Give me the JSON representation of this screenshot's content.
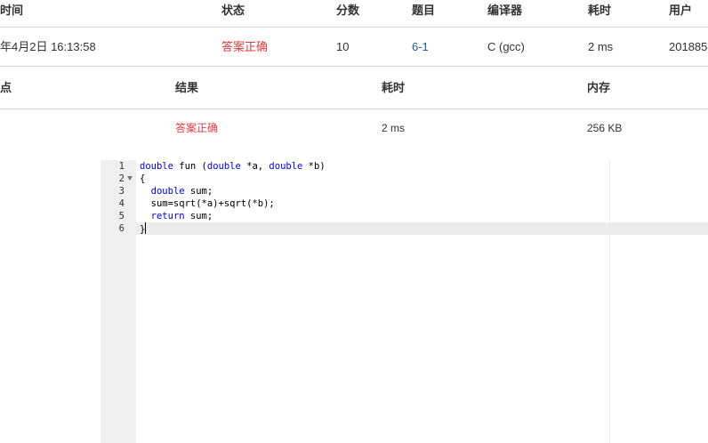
{
  "submission_table": {
    "headers": {
      "time": "时间",
      "status": "状态",
      "score": "分数",
      "problem": "题目",
      "compiler": "编译器",
      "duration": "耗时",
      "user": "用户"
    },
    "row": {
      "time": "年4月2日 16:13:58",
      "status": "答案正确",
      "score": "10",
      "problem": "6-1",
      "compiler": "C (gcc)",
      "duration": "2 ms",
      "user": "201885"
    }
  },
  "testcase_table": {
    "headers": {
      "point": "点",
      "result": "结果",
      "duration": "耗时",
      "memory": "内存"
    },
    "row": {
      "result": "答案正确",
      "duration": "2 ms",
      "memory": "256 KB"
    }
  },
  "code_editor": {
    "line_numbers": [
      "1",
      "2",
      "3",
      "4",
      "5",
      "6"
    ],
    "lines": [
      [
        {
          "t": "double",
          "k": true
        },
        {
          "t": " fun (",
          "k": false
        },
        {
          "t": "double",
          "k": true
        },
        {
          "t": " *a, ",
          "k": false
        },
        {
          "t": "double",
          "k": true
        },
        {
          "t": " *b)",
          "k": false
        }
      ],
      [
        {
          "t": "{",
          "k": false
        }
      ],
      [
        {
          "t": "  ",
          "k": false
        },
        {
          "t": "double",
          "k": true
        },
        {
          "t": " sum;",
          "k": false
        }
      ],
      [
        {
          "t": "  sum=sqrt(*a)+sqrt(*b);",
          "k": false
        }
      ],
      [
        {
          "t": "  ",
          "k": false
        },
        {
          "t": "return",
          "k": true
        },
        {
          "t": " sum;",
          "k": false
        }
      ],
      [
        {
          "t": "}",
          "k": false
        }
      ]
    ],
    "fold_icon": "fold-arrow-down-icon",
    "keyword_color": "#0000ff"
  },
  "colors": {
    "accepted": "#e03c3c",
    "link": "#1f5d9e"
  }
}
